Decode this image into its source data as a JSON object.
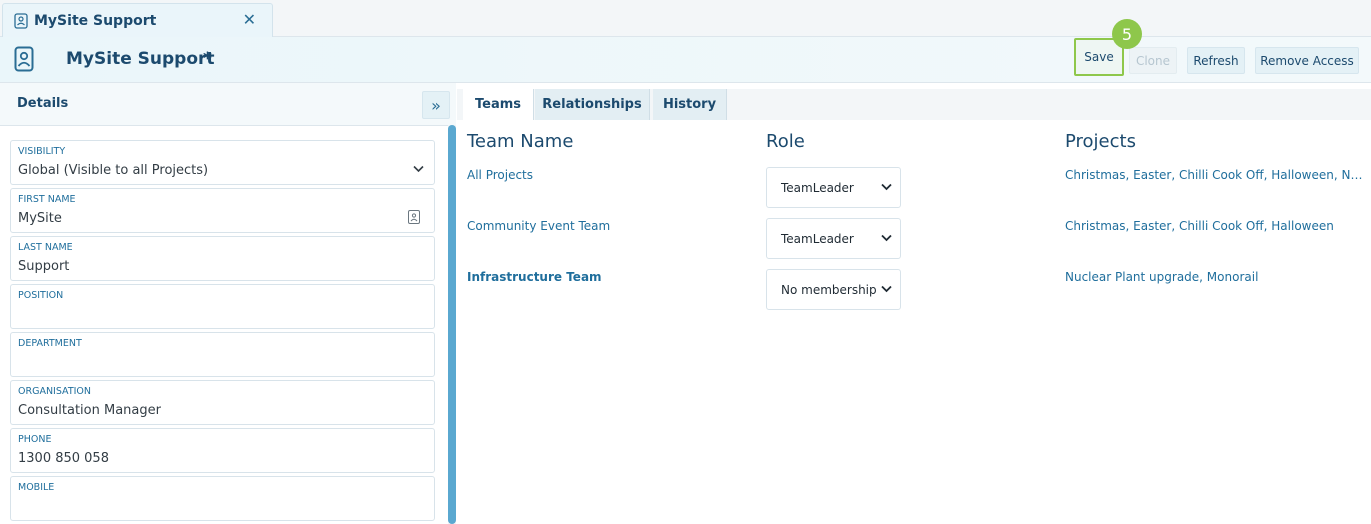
{
  "tab": {
    "title": "MySite Support",
    "close_glyph": "✕"
  },
  "header": {
    "title": "MySite Support",
    "dirty_marker": "*",
    "buttons": {
      "save": "Save",
      "clone": "Clone",
      "refresh": "Refresh",
      "remove_access": "Remove Access"
    },
    "step_badge": "5",
    "accent": "#8ec74b"
  },
  "details": {
    "title": "Details",
    "collapse_glyph": "»",
    "fields": [
      {
        "label": "VISIBILITY",
        "value": "Global (Visible to all Projects)"
      },
      {
        "label": "FIRST NAME",
        "value": "MySite"
      },
      {
        "label": "LAST NAME",
        "value": "Support"
      },
      {
        "label": "POSITION",
        "value": ""
      },
      {
        "label": "DEPARTMENT",
        "value": ""
      },
      {
        "label": "ORGANISATION",
        "value": "Consultation Manager"
      },
      {
        "label": "PHONE",
        "value": "1300 850 058"
      },
      {
        "label": "MOBILE",
        "value": ""
      }
    ]
  },
  "panel_tabs": {
    "teams": "Teams",
    "relationships": "Relationships",
    "history": "History"
  },
  "teams_table": {
    "headers": {
      "team": "Team Name",
      "role": "Role",
      "projects": "Projects"
    },
    "rows": [
      {
        "team": "All Projects",
        "role": "TeamLeader",
        "projects": "Christmas, Easter, Chilli Cook Off, Halloween, Nuclear Plant upgrade, Monorail"
      },
      {
        "team": "Community Event Team",
        "role": "TeamLeader",
        "projects": "Christmas, Easter, Chilli Cook Off, Halloween"
      },
      {
        "team": "Infrastructure Team",
        "role": "No membership",
        "projects": "Nuclear Plant upgrade, Monorail"
      }
    ]
  },
  "icons": {
    "chevron": "⌄",
    "select_chevron": "⌄"
  }
}
